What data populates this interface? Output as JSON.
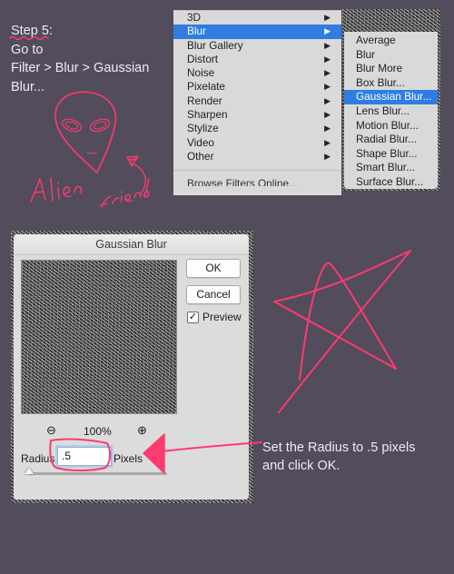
{
  "step": {
    "title": "Step 5:",
    "lines": [
      "Go to",
      "Filter > Blur > Gaussian",
      "Blur..."
    ]
  },
  "annotations": {
    "doodle_text_1": "Alien",
    "doodle_text_2": "friend",
    "instruction_line_1": "Set the Radius to .5 pixels",
    "instruction_line_2": "and click OK.",
    "ink_color": "#ff3a6e"
  },
  "filter_menu": {
    "items": [
      {
        "label": "3D",
        "submenu_arrow": "▶"
      },
      {
        "label": "Blur",
        "submenu_arrow": "▶",
        "active": true
      },
      {
        "label": "Blur Gallery",
        "submenu_arrow": "▶"
      },
      {
        "label": "Distort",
        "submenu_arrow": "▶"
      },
      {
        "label": "Noise",
        "submenu_arrow": "▶"
      },
      {
        "label": "Pixelate",
        "submenu_arrow": "▶"
      },
      {
        "label": "Render",
        "submenu_arrow": "▶"
      },
      {
        "label": "Sharpen",
        "submenu_arrow": "▶"
      },
      {
        "label": "Stylize",
        "submenu_arrow": "▶"
      },
      {
        "label": "Video",
        "submenu_arrow": "▶"
      },
      {
        "label": "Other",
        "submenu_arrow": "▶"
      }
    ],
    "footer_item": "Browse Filters Online..."
  },
  "blur_submenu": {
    "items": [
      {
        "label": "Average"
      },
      {
        "label": "Blur"
      },
      {
        "label": "Blur More"
      },
      {
        "label": "Box Blur..."
      },
      {
        "label": "Gaussian Blur...",
        "active": true
      },
      {
        "label": "Lens Blur..."
      },
      {
        "label": "Motion Blur..."
      },
      {
        "label": "Radial Blur..."
      },
      {
        "label": "Shape Blur..."
      },
      {
        "label": "Smart Blur..."
      },
      {
        "label": "Surface Blur..."
      }
    ]
  },
  "dialog": {
    "title": "Gaussian Blur",
    "ok_label": "OK",
    "cancel_label": "Cancel",
    "preview_label": "Preview",
    "preview_checked": true,
    "preview_check_glyph": "✓",
    "zoom_out_icon": "⊖",
    "zoom_in_icon": "⊕",
    "zoom_level": "100%",
    "radius_label": "Radius",
    "radius_value": ".5",
    "units_label": "Pixels",
    "slider_fraction": 0.0
  },
  "colors": {
    "background": "#524c5c",
    "menu_highlight": "#2f7de3",
    "ink": "#ff3a6e"
  }
}
